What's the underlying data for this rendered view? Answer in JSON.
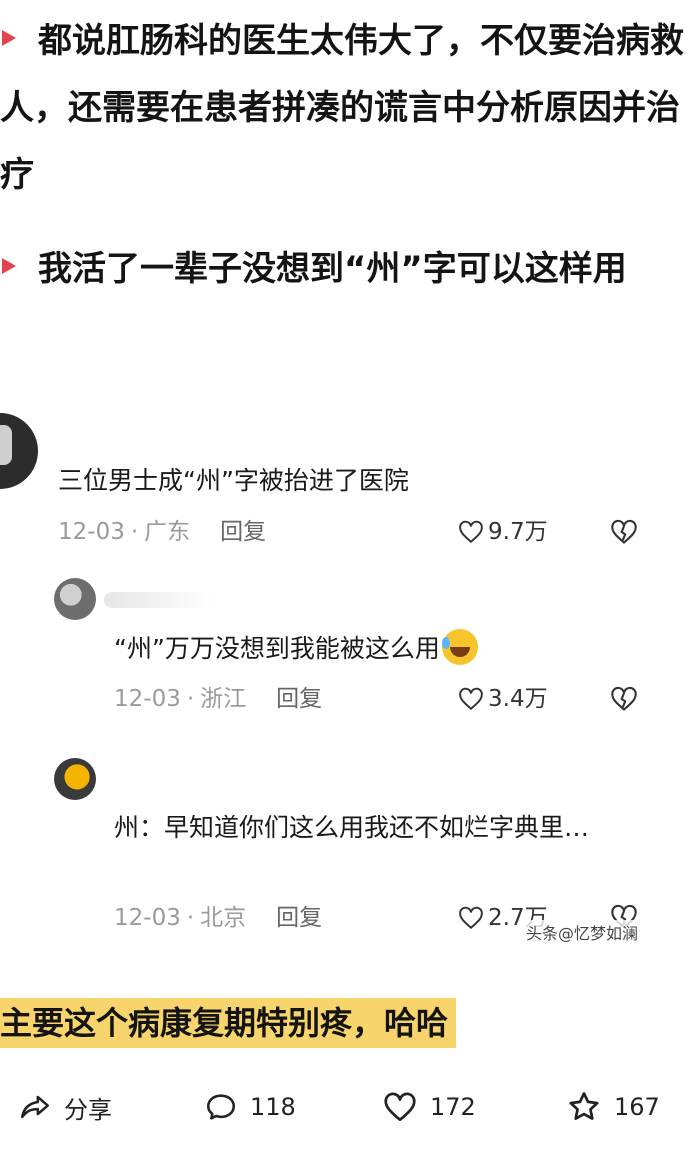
{
  "post": {
    "para1": "都说肛肠科的医生太伟大了，不仅要治病救人，还需要在患者拼凑的谎言中分析原因并治疗",
    "para2": "我活了一辈子没想到“州”字可以这样用"
  },
  "comments": [
    {
      "text": "三位男士成“州”字被抬进了医院",
      "date": "12-03",
      "location": "广东",
      "reply_label": "回复",
      "likes": "9.7万"
    },
    {
      "text": "“州”万万没想到我能被这么用",
      "date": "12-03",
      "location": "浙江",
      "reply_label": "回复",
      "likes": "3.4万"
    },
    {
      "text": "州：早知道你们这么用我还不如烂字典里…",
      "date": "12-03",
      "location": "北京",
      "reply_label": "回复",
      "likes": "2.7万"
    }
  ],
  "watermark": "头条@忆梦如澜",
  "caption": "主要这个病康复期特别疼，哈哈",
  "actions": {
    "share_label": "分享",
    "comment_count": "118",
    "like_count": "172",
    "favorite_count": "167"
  },
  "colors": {
    "bullet": "#e0434b",
    "highlight": "#f7d46c",
    "meta_gray": "#9a9a9a"
  },
  "icons": [
    "share-icon",
    "comment-icon",
    "heart-icon",
    "star-icon",
    "broken-heart-icon",
    "laughing-emoji-icon"
  ]
}
